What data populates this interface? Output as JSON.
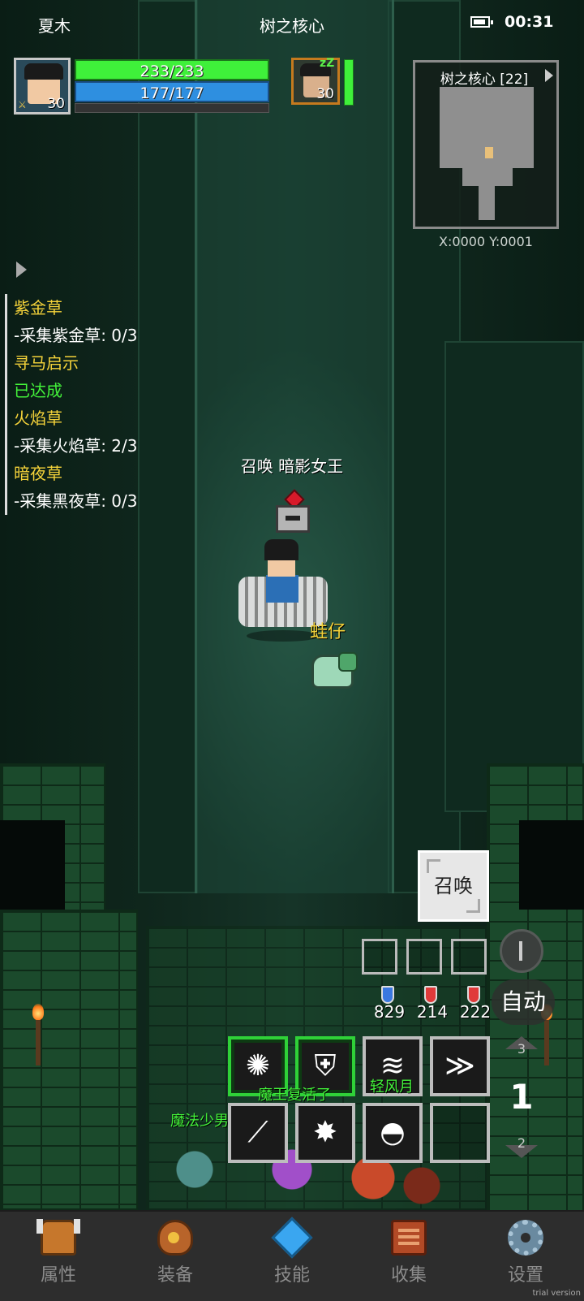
{
  "header": {
    "player_name": "夏木",
    "map_name": "树之核心",
    "time": "00:31"
  },
  "player": {
    "level": "30",
    "hp": "233/233",
    "mp": "177/177",
    "portrait_icon": "hero-portrait"
  },
  "companion": {
    "level": "30",
    "status_icon": "sleep-icon",
    "status_text": "zZ"
  },
  "minimap": {
    "title": "树之核心 [22]",
    "coords": "X:0000  Y:0001"
  },
  "quests": [
    {
      "title": "紫金草",
      "detail": "-采集紫金草: 0/3",
      "detail_style": "step"
    },
    {
      "title": "寻马启示",
      "detail": "已达成",
      "detail_style": "done"
    },
    {
      "title": "火焰草",
      "detail": "-采集火焰草: 2/3",
      "detail_style": "step"
    },
    {
      "title": "暗夜草",
      "detail": "-采集黑夜草: 0/3",
      "detail_style": "step"
    }
  ],
  "world": {
    "summon_target_label": "召唤 暗影女王",
    "pet_name": "蛙仔"
  },
  "actions": {
    "summon_label": "召唤",
    "auto_label": "自动",
    "page_current": "1",
    "page_up": "3",
    "page_down": "2"
  },
  "potions": [
    {
      "count": "829",
      "color": "#3a78e0"
    },
    {
      "count": "214",
      "color": "#e03a3a"
    },
    {
      "count": "222",
      "color": "#e03a3a"
    }
  ],
  "skills": [
    {
      "icon": "radiant-burst-icon",
      "glyph": "✺",
      "active": true
    },
    {
      "icon": "holy-shield-icon",
      "glyph": "⛨",
      "active": true
    },
    {
      "icon": "claw-slash-icon",
      "glyph": "≋",
      "active": false
    },
    {
      "icon": "dash-strike-icon",
      "glyph": "≫",
      "active": false
    },
    {
      "icon": "feather-blade-icon",
      "glyph": "⟋",
      "active": false
    },
    {
      "icon": "shatter-icon",
      "glyph": "✸",
      "active": false
    },
    {
      "icon": "hooded-mage-icon",
      "glyph": "◓",
      "active": false
    },
    {
      "icon": "empty-slot",
      "glyph": "",
      "active": false
    }
  ],
  "chat": {
    "name1": "魔法少男",
    "name2": "魔王复活了",
    "name3": "轻风月"
  },
  "nav": [
    {
      "label": "属性",
      "icon": "helmet-icon"
    },
    {
      "label": "装备",
      "icon": "bag-icon"
    },
    {
      "label": "技能",
      "icon": "crystal-icon"
    },
    {
      "label": "收集",
      "icon": "book-icon"
    },
    {
      "label": "设置",
      "icon": "gear-icon"
    }
  ],
  "watermark": "trial version"
}
